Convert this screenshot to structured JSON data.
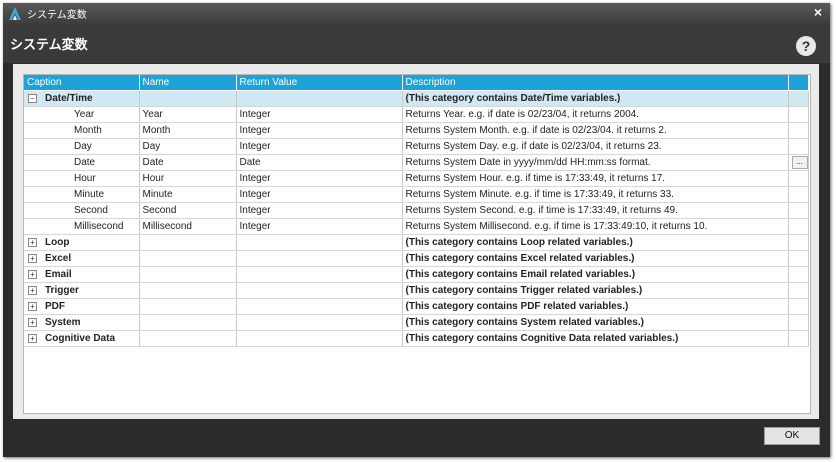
{
  "window": {
    "title": "システム変数",
    "close": "×"
  },
  "header": {
    "title": "システム変数",
    "help": "?"
  },
  "grid": {
    "columns": [
      "Caption",
      "Name",
      "Return Value",
      "Description"
    ],
    "date_time": {
      "caption": "Date/Time",
      "description": "(This category contains Date/Time variables.)",
      "children": [
        {
          "caption": "Year",
          "name": "Year",
          "ret": "Integer",
          "desc": "Returns Year. e.g. if date is 02/23/04, it returns 2004."
        },
        {
          "caption": "Month",
          "name": "Month",
          "ret": "Integer",
          "desc": "Returns System Month. e.g. if date is 02/23/04. it returns 2."
        },
        {
          "caption": "Day",
          "name": "Day",
          "ret": "Integer",
          "desc": "Returns System Day. e.g. if date is 02/23/04, it returns 23."
        },
        {
          "caption": "Date",
          "name": "Date",
          "ret": "Date",
          "desc": "Returns System Date in yyyy/mm/dd HH:mm:ss format.",
          "button": "..."
        },
        {
          "caption": "Hour",
          "name": "Hour",
          "ret": "Integer",
          "desc": "Returns System Hour. e.g. if time is 17:33:49, it returns 17."
        },
        {
          "caption": "Minute",
          "name": "Minute",
          "ret": "Integer",
          "desc": "Returns System Minute. e.g. if time is 17:33:49, it returns 33."
        },
        {
          "caption": "Second",
          "name": "Second",
          "ret": "Integer",
          "desc": "Returns System Second. e.g. if time is 17:33:49, it returns 49."
        },
        {
          "caption": "Millisecond",
          "name": "Millisecond",
          "ret": "Integer",
          "desc": "Returns System Millisecond. e.g. if time is 17:33:49:10, it returns 10."
        }
      ]
    },
    "categories": [
      {
        "caption": "Loop",
        "description": "(This category contains Loop related variables.)"
      },
      {
        "caption": "Excel",
        "description": "(This category contains Excel related variables.)"
      },
      {
        "caption": "Email",
        "description": "(This category contains Email related variables.)"
      },
      {
        "caption": "Trigger",
        "description": "(This category contains Trigger related variables.)"
      },
      {
        "caption": "PDF",
        "description": "(This category contains PDF related variables.)"
      },
      {
        "caption": "System",
        "description": "(This category contains System related variables.)"
      },
      {
        "caption": "Cognitive Data",
        "description": "(This category contains Cognitive Data related variables.)"
      }
    ],
    "collapse_glyph": "−",
    "expand_glyph": "+"
  },
  "footer": {
    "ok_label": "OK"
  }
}
